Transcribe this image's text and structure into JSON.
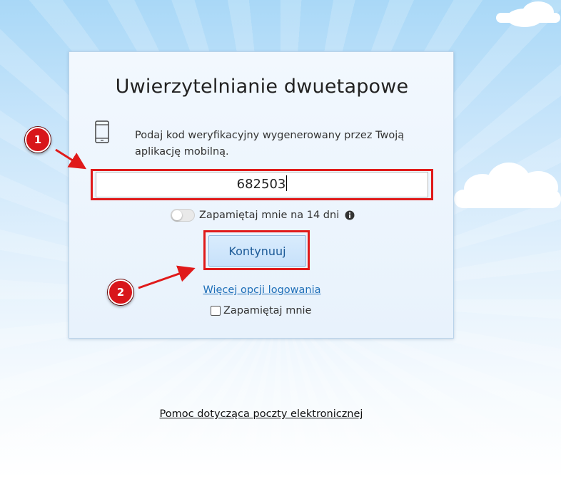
{
  "card": {
    "title": "Uwierzytelnianie dwuetapowe",
    "instructions": "Podaj kod weryfikacyjny wygenerowany przez Twoją aplikację mobilną.",
    "code_value": "682503",
    "remember_14_label": "Zapamiętaj mnie na 14 dni",
    "remember_14_checked": false,
    "continue_label": "Kontynuuj",
    "more_options_label": "Więcej opcji logowania",
    "remember_me_label": "Zapamiętaj mnie",
    "remember_me_checked": false
  },
  "footer": {
    "help_link": "Pomoc dotycząca poczty elektronicznej"
  },
  "annotations": {
    "badge_1": "1",
    "badge_2": "2",
    "color": "#e01a1a"
  },
  "icons": {
    "phone": "mobile-phone-icon",
    "info": "info-icon"
  },
  "colors": {
    "link": "#1f6fb8",
    "button_text": "#1c5a97",
    "button_bg": "#d0e7fc",
    "card_bg": "#eef5fd"
  }
}
